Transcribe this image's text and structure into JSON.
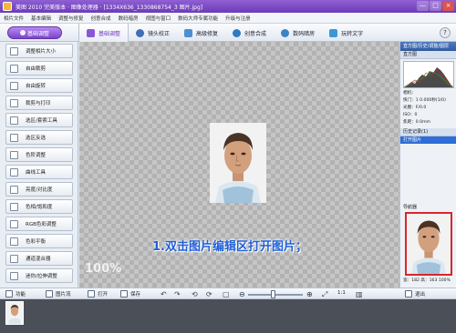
{
  "window": {
    "title": "美图 2010 完美版本 · 图像处理器 · [1334X636_1330868754_3 图片.jpg]",
    "buttons": [
      "—",
      "□",
      "×"
    ]
  },
  "menubar": {
    "items": [
      "相片文件",
      "基本编辑",
      "调整与修复",
      "创意合成",
      "数码暗房",
      "视图与窗口",
      "数码大师专属功能",
      "升级与注册"
    ]
  },
  "toolbar": {
    "basic_label": "基础调整",
    "tabs": [
      {
        "label": "基础调整"
      },
      {
        "label": "镜头校正"
      },
      {
        "label": "高级修复"
      },
      {
        "label": "创意合成"
      },
      {
        "label": "数码暗房"
      },
      {
        "label": "玩转文字"
      }
    ],
    "help_label": "?"
  },
  "left_panel": {
    "buttons": [
      "调整相片大小",
      "自由裁剪",
      "自由旋转",
      "裁剪与打印",
      "选区/套索工具",
      "选区反选",
      "色阶调整",
      "曲线工具",
      "亮度/对比度",
      "色相/饱和度",
      "RGB色彩调整",
      "色彩平衡",
      "通道混合器",
      "迷你/拉伸调整"
    ]
  },
  "canvas": {
    "zoom": "100%",
    "caption": "1.双击图片编辑区打开图片；"
  },
  "right_panel": {
    "header": "直方图/历史/调整/图层",
    "histogram_label": "直方图",
    "info": [
      "相机：",
      "快门：1 0.000秒(1/0)",
      "光圈：F/0.0",
      "ISO：0",
      "焦距：0.0mm"
    ],
    "history_label": "历史记录(1)",
    "history_items": [
      "打开图片"
    ],
    "navigator_label": "导航器",
    "navigator_zoom": "宽：182  高：163  100%"
  },
  "bottombar": {
    "func_label": "功能",
    "film_label": "图片流",
    "open_label": "打开",
    "save_label": "保存",
    "ratio_label": "1:1",
    "exit_label": "退出"
  },
  "colors": {
    "accent": "#7b44cc",
    "title_bar": "#6c3cb8",
    "caption": "#1f5fd6",
    "panel_header": "#2f5a9e",
    "selection": "#2f6ed8",
    "navigator_border": "#d9262c"
  }
}
